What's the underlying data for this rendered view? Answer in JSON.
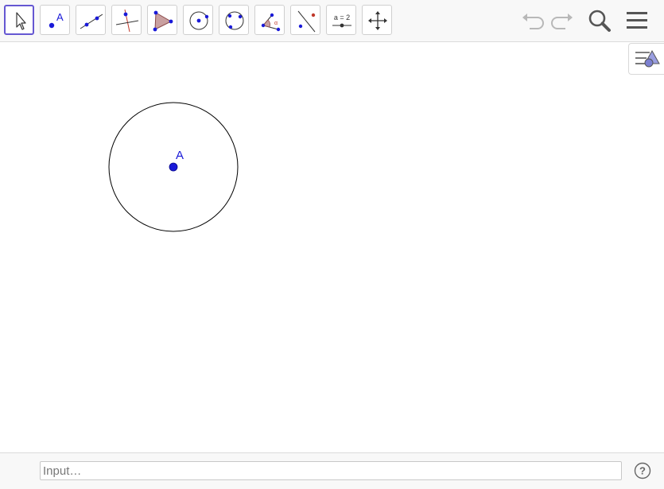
{
  "input": {
    "placeholder": "Input…"
  },
  "tools": [
    {
      "name": "move-tool",
      "icon": "arrow-cursor-icon",
      "selected": true
    },
    {
      "name": "point-tool",
      "icon": "point-icon",
      "label": "A"
    },
    {
      "name": "line-tool",
      "icon": "line-icon"
    },
    {
      "name": "perpendicular-line-tool",
      "icon": "perpendicular-line-icon"
    },
    {
      "name": "polygon-tool",
      "icon": "polygon-icon"
    },
    {
      "name": "circle-center-point-tool",
      "icon": "circle-center-point-icon"
    },
    {
      "name": "circle-three-points-tool",
      "icon": "circle-three-points-icon"
    },
    {
      "name": "angle-tool",
      "icon": "angle-icon"
    },
    {
      "name": "reflect-tool",
      "icon": "reflect-about-line-icon"
    },
    {
      "name": "slider-tool",
      "icon": "slider-icon",
      "label": "a = 2"
    },
    {
      "name": "move-graphics-view-tool",
      "icon": "move-graphics-view-icon"
    }
  ],
  "canvas": {
    "point": {
      "label": "A",
      "color": "#1a1ad8"
    }
  },
  "colors": {
    "selection": "#6557d2",
    "point": "#1a1ad8",
    "polygon_fill": "#c9a0a0"
  }
}
